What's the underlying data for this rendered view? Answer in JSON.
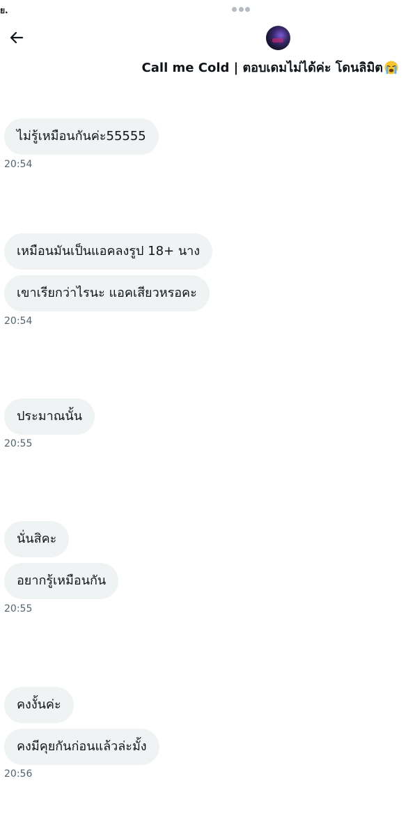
{
  "status_bar": {
    "fragment": "ย."
  },
  "header": {
    "back_label": "Back",
    "title": "Call me Cold | ตอบเดมไม่ได้ค่ะ โดนลิมิต",
    "title_emoji": "loudly-crying-face-emoji",
    "more_icon": "ellipsis-icon"
  },
  "messages": [
    {
      "text": "ไม่รู้เหมือนกันค่ะ55555"
    },
    {
      "text": "เหมือนมันเป็นแอคลงรูป 18+ นาง"
    },
    {
      "text": "เขาเรียกว่าไรนะ แอคเสียวหรอคะ"
    },
    {
      "text": "ประมาณนั้น"
    },
    {
      "text": "นั่นสิคะ"
    },
    {
      "text": "อยากรู้เหมือนกัน"
    },
    {
      "text": "คงงั้นค่ะ"
    },
    {
      "text": "คงมีคุยกันก่อนแล้วล่ะมั้ง"
    }
  ],
  "timestamps": [
    "20:54",
    "20:54",
    "20:55",
    "20:55",
    "20:56"
  ],
  "colors": {
    "bubble": "#eff3f4",
    "text": "#0f1419",
    "timestamp": "#536471"
  }
}
